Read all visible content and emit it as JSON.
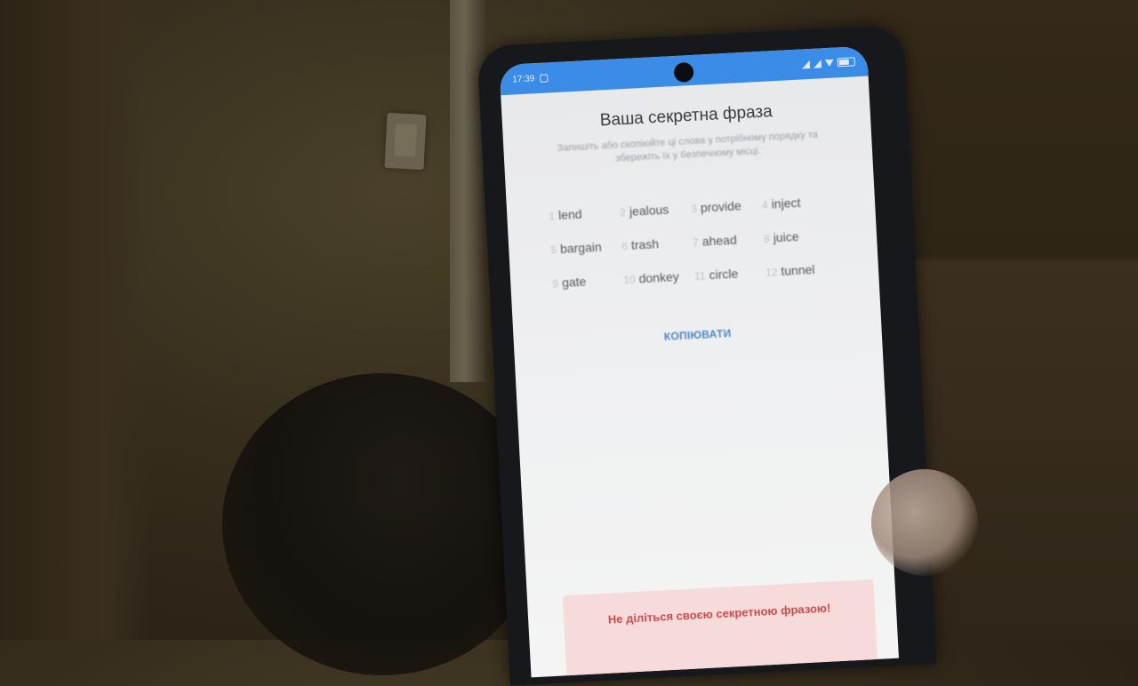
{
  "status_bar": {
    "time": "17:39"
  },
  "screen": {
    "title": "Ваша секретна фраза",
    "subtitle": "Запишіть або скопіюйте ці слова у потрібному порядку та збережіть їх у безпечному місці.",
    "words": [
      {
        "num": "1",
        "word": "lend"
      },
      {
        "num": "2",
        "word": "jealous"
      },
      {
        "num": "3",
        "word": "provide"
      },
      {
        "num": "4",
        "word": "inject"
      },
      {
        "num": "5",
        "word": "bargain"
      },
      {
        "num": "6",
        "word": "trash"
      },
      {
        "num": "7",
        "word": "ahead"
      },
      {
        "num": "8",
        "word": "juice"
      },
      {
        "num": "9",
        "word": "gate"
      },
      {
        "num": "10",
        "word": "donkey"
      },
      {
        "num": "11",
        "word": "circle"
      },
      {
        "num": "12",
        "word": "tunnel"
      }
    ],
    "copy_label": "КОПІЮВАТИ",
    "warning": "Не діліться своєю секретною фразою!"
  }
}
